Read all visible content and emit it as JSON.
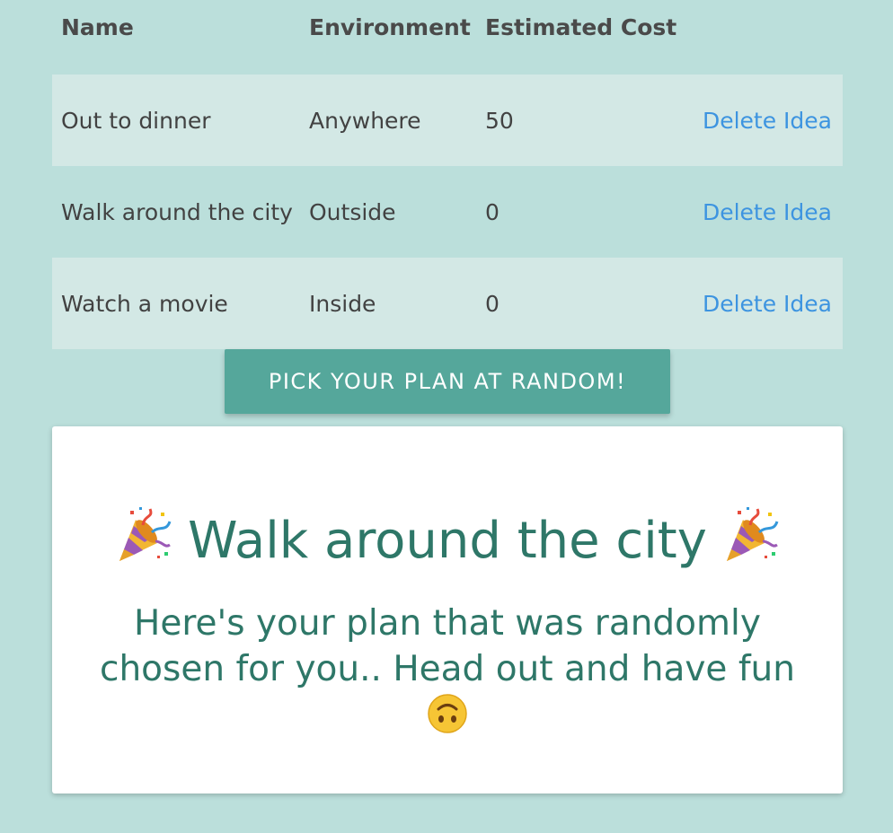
{
  "table": {
    "headers": {
      "name": "Name",
      "environment": "Environment",
      "estimated_cost": "Estimated Cost"
    },
    "rows": [
      {
        "name": "Out to dinner",
        "environment": "Anywhere",
        "cost": "50",
        "action": "Delete Idea"
      },
      {
        "name": "Walk around the city",
        "environment": "Outside",
        "cost": "0",
        "action": "Delete Idea"
      },
      {
        "name": "Watch a movie",
        "environment": "Inside",
        "cost": "0",
        "action": "Delete Idea"
      }
    ]
  },
  "pick_button": {
    "label": "PICK YOUR PLAN AT RANDOM!"
  },
  "result_card": {
    "title": "Walk around the city",
    "subtitle": "Here's your plan that was randomly chosen for you.. Head out and have fun",
    "title_icon": "party-popper-icon",
    "subtitle_icon": "upside-down-face-icon"
  },
  "colors": {
    "background": "#bbdfdb",
    "stripe": "#d3e8e5",
    "link": "#3d94e0",
    "button": "#55a79b",
    "card_text": "#2e7768"
  }
}
